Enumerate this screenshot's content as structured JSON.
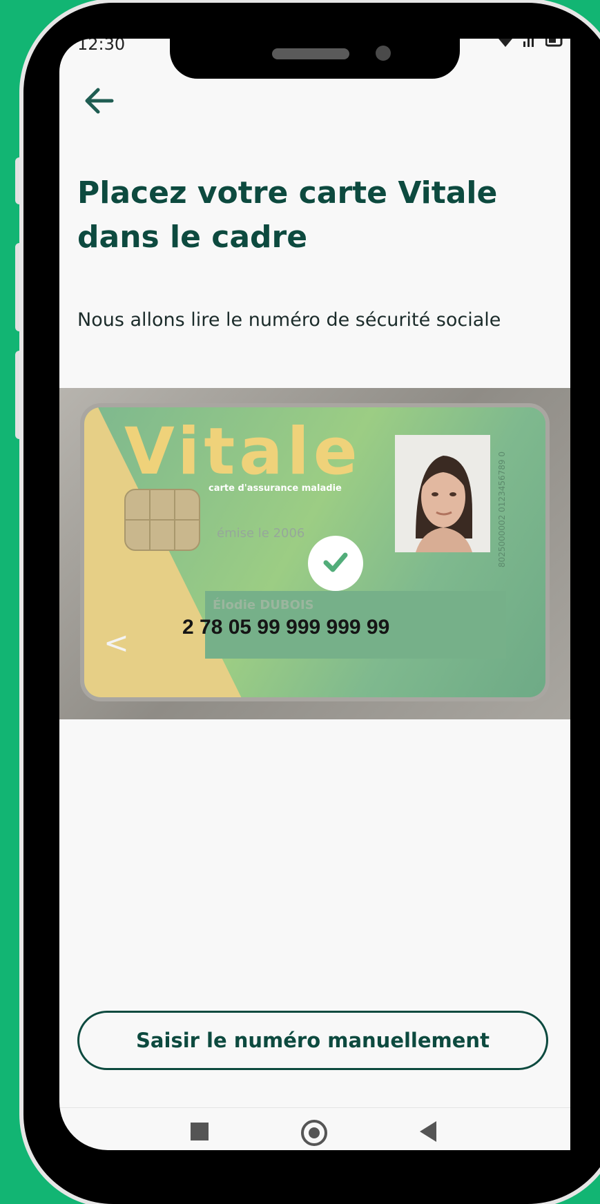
{
  "status_bar": {
    "time": "12:30",
    "icons": [
      "wifi-icon",
      "signal-icon",
      "battery-icon"
    ]
  },
  "header": {
    "back_icon": "arrow-left-icon"
  },
  "main": {
    "title": "Placez votre carte Vitale dans le cadre",
    "subtitle": "Nous allons lire le numéro de sécurité sociale"
  },
  "card": {
    "logo": "Vitale",
    "tagline": "carte d'assurance maladie",
    "issued": "émise le        2006",
    "name": "Élodie DUBOIS",
    "ssn": "2 78 05 99 999 999 99",
    "vertical_number": "8025000002 0123456789 0",
    "chevron": "<",
    "status_icon": "check-icon"
  },
  "actions": {
    "manual_label": "Saisir le numéro manuellement"
  },
  "nav_bar": {
    "items": [
      "recents-icon",
      "home-icon",
      "back-icon"
    ]
  },
  "colors": {
    "background": "#12b573",
    "primary": "#0d4a3f",
    "card_green": "#7fb98e",
    "card_yellow": "#e6cf86"
  }
}
